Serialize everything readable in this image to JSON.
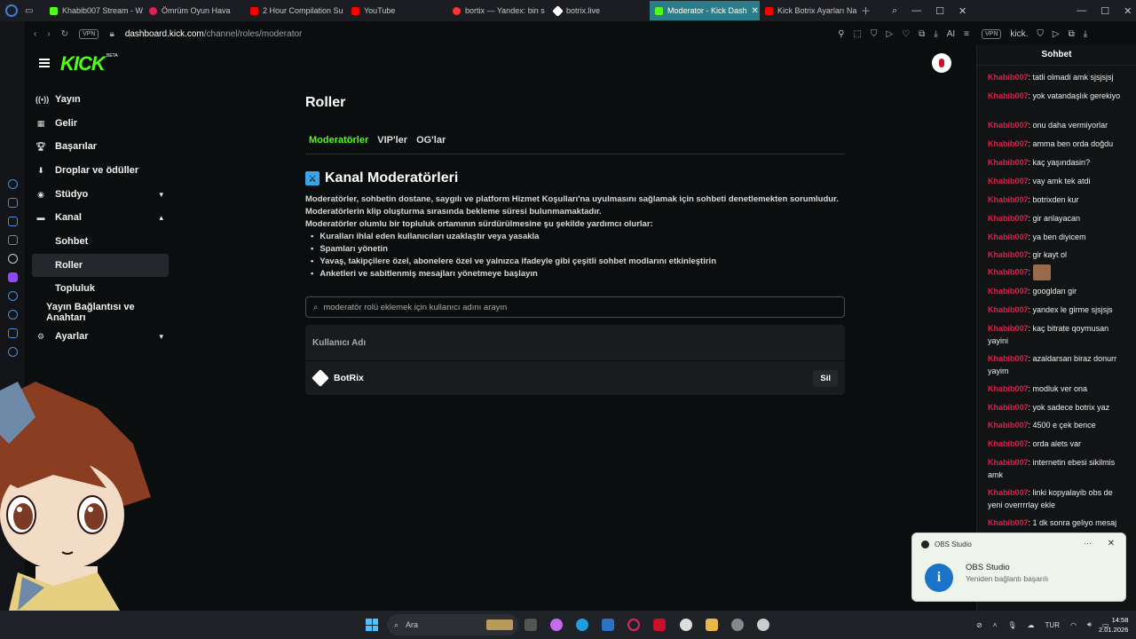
{
  "browser": {
    "tabs": [
      {
        "label": "Khabib007 Stream - W",
        "color": "#53fc18"
      },
      {
        "label": "Ömrüm Oyun Hava",
        "color": "#e01e5a"
      },
      {
        "label": "2 Hour Compilation Su",
        "color": "#ff0000"
      },
      {
        "label": "YouTube",
        "color": "#ff0000"
      },
      {
        "label": "bortix — Yandex: bin s",
        "color": "#ff3333"
      },
      {
        "label": "botrix.live",
        "color": "#ffffff"
      },
      {
        "label": "Moderator - Kick Dash",
        "color": "#53fc18",
        "active": true
      },
      {
        "label": "Kick Botrix Ayarları Na",
        "color": "#ff0000"
      }
    ],
    "vpn_label": "VPN",
    "url_host": "dashboard.kick.com",
    "url_path": "/channel/roles/moderator",
    "ai_label": "AI",
    "side_vpn": "VPN",
    "side_url": "kick."
  },
  "kick": {
    "logo": "KICK",
    "beta": "BETA",
    "nav": {
      "stream": "Yayın",
      "revenue": "Gelir",
      "achievements": "Başarılar",
      "drops": "Droplar ve ödüller",
      "studio": "Stüdyo",
      "channel": "Kanal",
      "chat": "Sohbet",
      "roles": "Roller",
      "community": "Topluluk",
      "stream_key": "Yayın Bağlantısı ve Anahtarı",
      "settings": "Ayarlar"
    },
    "page_title": "Roller",
    "tabs": {
      "mods": "Moderatörler",
      "vips": "VIP'ler",
      "ogs": "OG'lar"
    },
    "section_title": "Kanal Moderatörleri",
    "desc1": "Moderatörler, sohbetin dostane, saygılı ve platform Hizmet Koşulları'na uyulmasını sağlamak için sohbeti denetlemekten sorumludur.",
    "desc2": "Moderatörlerin klip oluşturma sırasında bekleme süresi bulunmamaktadır.",
    "desc3": "Moderatörler olumlu bir topluluk ortamının sürdürülmesine şu şekilde yardımcı olurlar:",
    "bullets": [
      "Kuralları ihlal eden kullanıcıları uzaklaştır veya yasakla",
      "Spamları yönetin",
      "Yavaş, takipçilere özel, abonelere özel ve yalnızca ifadeyle gibi çeşitli sohbet modlarını etkinleştirin",
      "Anketleri ve sabitlenmiş mesajları yönetmeye başlayın"
    ],
    "search_placeholder": "moderatör rolü eklemek için kullanıcı adını arayın",
    "table_header": "Kullanıcı Adı",
    "moderator": "BotRix",
    "delete_label": "Sil"
  },
  "chat": {
    "title": "Sohbet",
    "messages": [
      {
        "user": "Khabib007",
        "text": "tatli olmadi amk sjsjsjsj"
      },
      {
        "user": "Khabib007",
        "text": "yok vatandaşlık gerekiyo"
      },
      {
        "user": "Khabib007",
        "text": "onu daha vermiyorlar"
      },
      {
        "user": "Khabib007",
        "text": "amma ben orda doğdu"
      },
      {
        "user": "Khabib007",
        "text": "kaç yaşındasin?"
      },
      {
        "user": "Khabib007",
        "text": "vay amk tek atdi"
      },
      {
        "user": "Khabib007",
        "text": "botrixden kur"
      },
      {
        "user": "Khabib007",
        "text": "gir anlayacan"
      },
      {
        "user": "Khabib007",
        "text": "ya ben diyicem"
      },
      {
        "user": "Khabib007",
        "text": "gir kayt ol"
      },
      {
        "user": "Khabib007",
        "text": ""
      },
      {
        "user": "Khabib007",
        "text": "googldan gir"
      },
      {
        "user": "Khabib007",
        "text": "yandex le girme sjsjsjs"
      },
      {
        "user": "Khabib007",
        "text": "kaç bitrate qoymusan yayini"
      },
      {
        "user": "Khabib007",
        "text": "azaldarsan biraz donurr yayim"
      },
      {
        "user": "Khabib007",
        "text": "modluk ver ona"
      },
      {
        "user": "Khabib007",
        "text": "yok sadece botrix yaz"
      },
      {
        "user": "Khabib007",
        "text": "4500 e çek bence"
      },
      {
        "user": "Khabib007",
        "text": "orda alets var"
      },
      {
        "user": "Khabib007",
        "text": "internetin ebesi sikilmis amk"
      },
      {
        "user": "Khabib007",
        "text": "linki kopyalayib obs de yeni overrrrlay ekle"
      },
      {
        "user": "Khabib007",
        "text": "1 dk sonra geliyo mesaj"
      }
    ]
  },
  "toast": {
    "app": "OBS Studio",
    "dots": "···",
    "title": "OBS Studio",
    "body": "Yeniden bağlantı başarılı"
  },
  "taskbar": {
    "search": "Ara",
    "lang": "TUR",
    "time": "14:58",
    "date": "2.01.2026",
    "gx": "GX"
  }
}
